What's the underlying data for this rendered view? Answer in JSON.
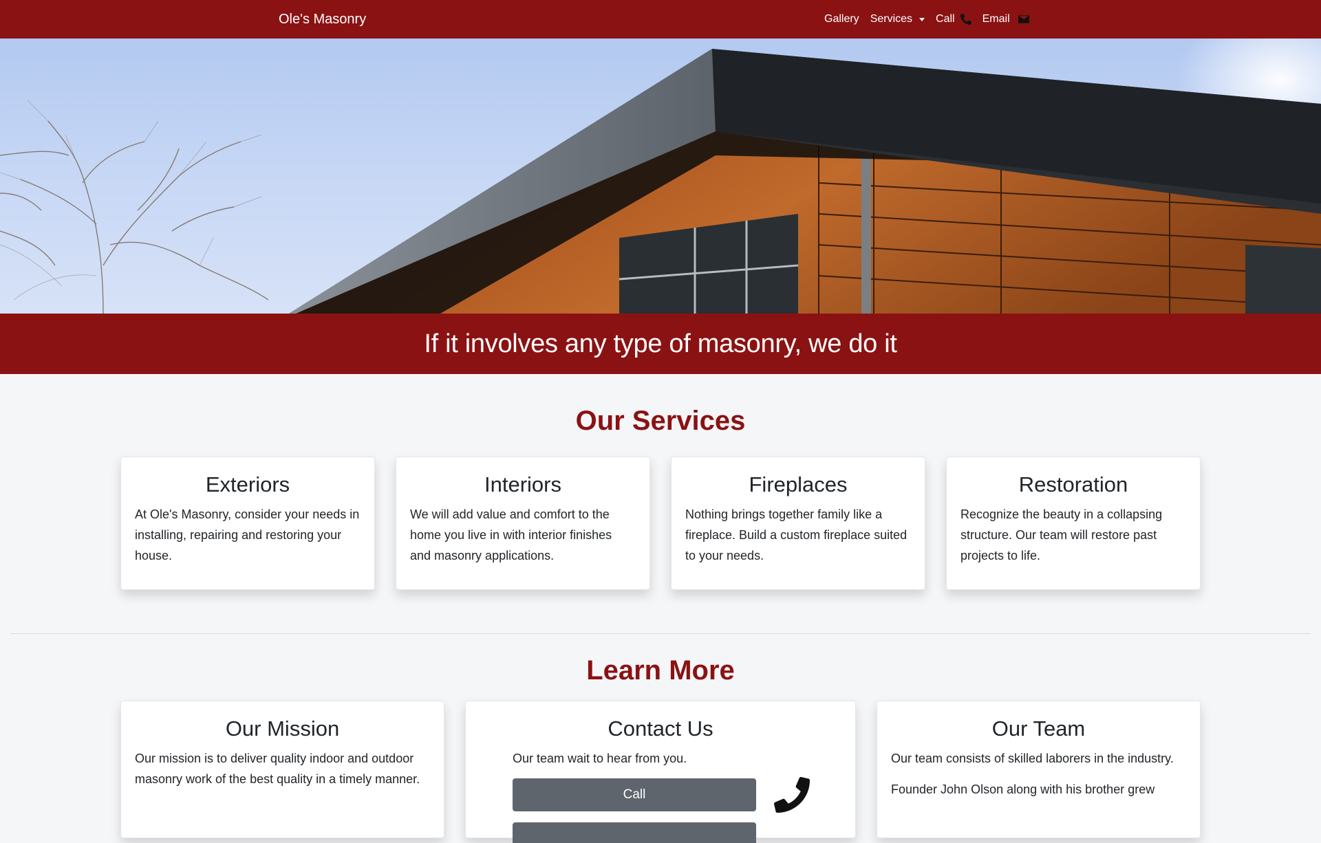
{
  "nav": {
    "brand": "Ole's Masonry",
    "links": {
      "gallery": "Gallery",
      "services": "Services",
      "call": "Call",
      "email": "Email"
    }
  },
  "banner": {
    "text": "If it involves any type of masonry, we do it"
  },
  "services": {
    "title": "Our Services",
    "cards": [
      {
        "title": "Exteriors",
        "text": "At Ole's Masonry, consider your needs in installing, repairing and restoring your house."
      },
      {
        "title": "Interiors",
        "text": "We will add value and comfort to the home you live in with interior finishes and masonry applications."
      },
      {
        "title": "Fireplaces",
        "text": "Nothing brings together family like a fireplace. Build a custom fireplace suited to your needs."
      },
      {
        "title": "Restoration",
        "text": "Recognize the beauty in a collapsing structure. Our team will restore past projects to life."
      }
    ]
  },
  "learn": {
    "title": "Learn More",
    "mission": {
      "title": "Our Mission",
      "text": "Our mission is to deliver quality indoor and outdoor masonry work of the best quality in a timely manner."
    },
    "contact": {
      "title": "Contact Us",
      "text": "Our team wait to hear from you.",
      "call_button": "Call"
    },
    "team": {
      "title": "Our Team",
      "text1": "Our team consists of skilled laborers in the industry.",
      "text2": "Founder John Olson along with his brother grew"
    }
  },
  "colors": {
    "brand": "#8b1213",
    "button": "#5f656c",
    "background": "#f5f6f8"
  },
  "icons": {
    "call": "phone-icon",
    "email": "envelope-icon"
  }
}
